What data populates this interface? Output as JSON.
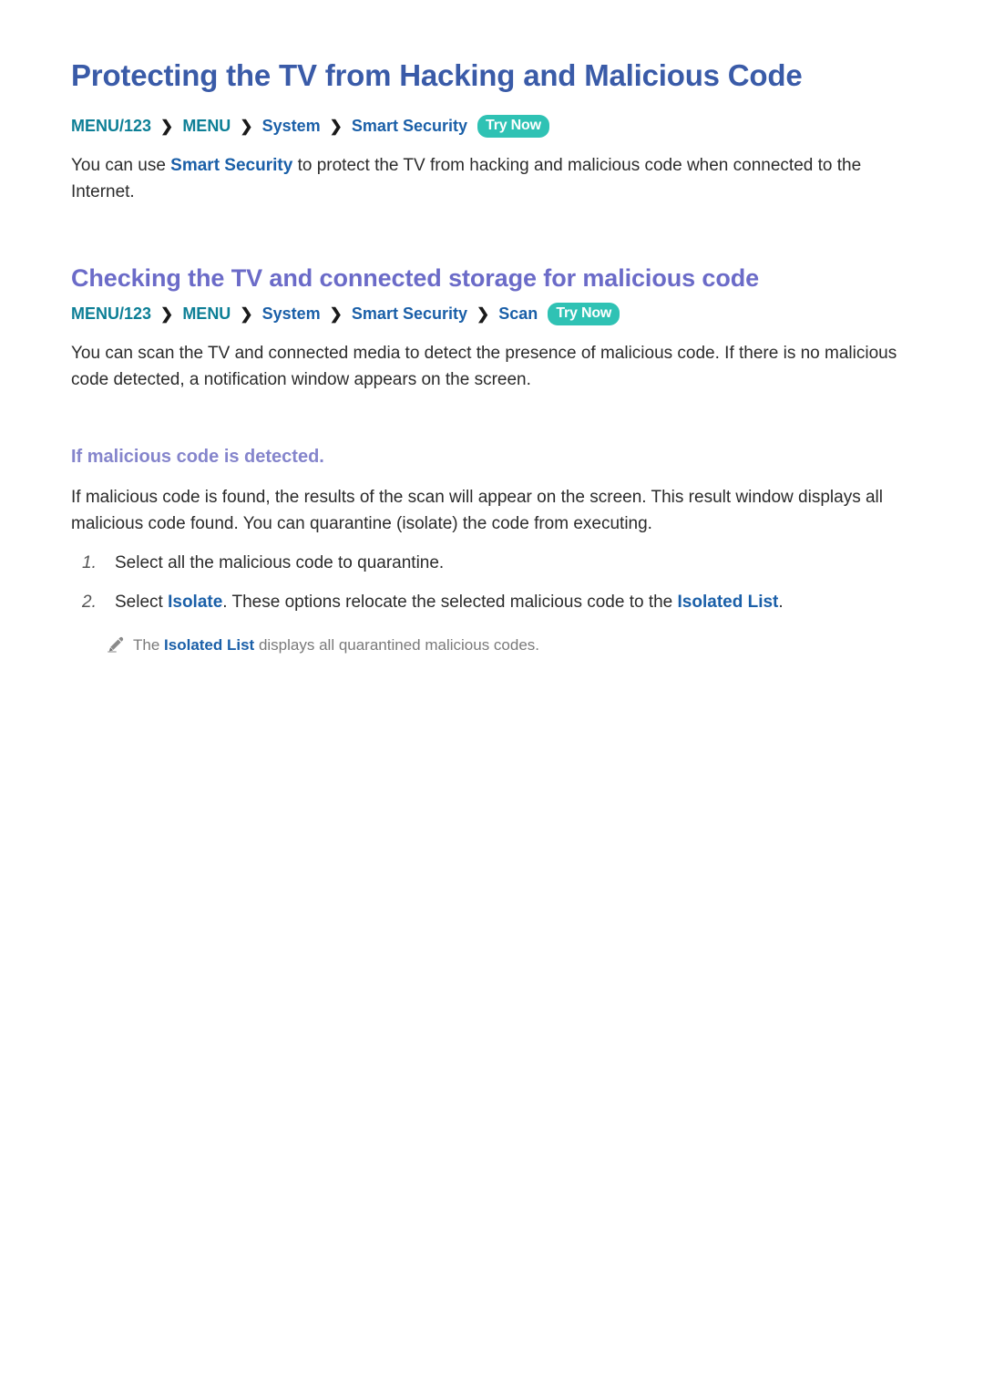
{
  "document": {
    "title": "Protecting the TV from Hacking and Malicious Code"
  },
  "section1": {
    "heading": "Protecting the TV from Hacking and Malicious Code",
    "breadcrumb": {
      "items": [
        "MENU/123",
        "MENU",
        "System",
        "Smart Security"
      ],
      "separator": "❯",
      "badge": "Try Now"
    },
    "paragraph": {
      "pre": "You can use ",
      "link": "Smart Security",
      "post": " to protect the TV from hacking and malicious code when connected to the Internet."
    }
  },
  "section2": {
    "heading": "Checking the TV and connected storage for malicious code",
    "breadcrumb": {
      "items": [
        "MENU/123",
        "MENU",
        "System",
        "Smart Security",
        "Scan"
      ],
      "separator": "❯",
      "badge": "Try Now"
    },
    "paragraph": "You can scan the TV and connected media to detect the presence of malicious code. If there is no malicious code detected, a notification window appears on the screen."
  },
  "section3": {
    "heading": "If malicious code is detected.",
    "paragraph": "If malicious code is found, the results of the scan will appear on the screen. This result window displays all malicious code found. You can quarantine (isolate) the code from executing.",
    "steps": [
      {
        "number": "1.",
        "pre": "Select all the malicious code to quarantine.",
        "link": "",
        "mid": "",
        "link2": "",
        "post": ""
      },
      {
        "number": "2.",
        "pre": "Select ",
        "link": "Isolate",
        "mid": ". These options relocate the selected malicious code to the ",
        "link2": "Isolated List",
        "post": "."
      }
    ],
    "note": {
      "icon": "pencil-icon",
      "pre": "The ",
      "link": "Isolated List",
      "post": " displays all quarantined malicious codes."
    }
  },
  "colors": {
    "h1": "#3a5ba8",
    "h2": "#6b6bc8",
    "h3": "#8585cc",
    "teal_link": "#0d7f96",
    "blue_link": "#1a5fa8",
    "badge_bg": "#2fc2b4",
    "body_text": "#2b2b2b",
    "note_text": "#7a7a7a"
  }
}
